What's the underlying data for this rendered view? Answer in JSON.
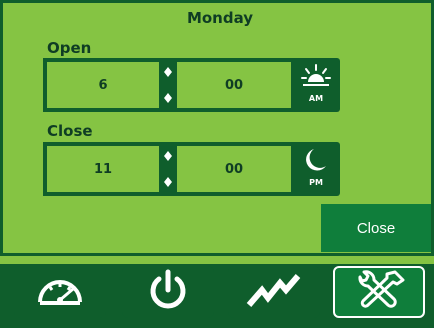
{
  "header": {
    "title": "Monday"
  },
  "open": {
    "label": "Open",
    "hour": "6",
    "minute": "00",
    "period": "AM",
    "period_icon": "sunrise-icon"
  },
  "close": {
    "label": "Close",
    "hour": "11",
    "minute": "00",
    "period": "PM",
    "period_icon": "moon-icon"
  },
  "actions": {
    "close_label": "Close"
  },
  "nav": {
    "items": [
      {
        "icon": "speedometer-icon"
      },
      {
        "icon": "power-icon"
      },
      {
        "icon": "trend-icon"
      },
      {
        "icon": "tools-icon",
        "active": true
      }
    ]
  },
  "colors": {
    "background": "#85c443",
    "border": "#0f5e2c",
    "text": "#0f3d24",
    "button": "#0f7e3b",
    "icon": "#ffffff"
  }
}
